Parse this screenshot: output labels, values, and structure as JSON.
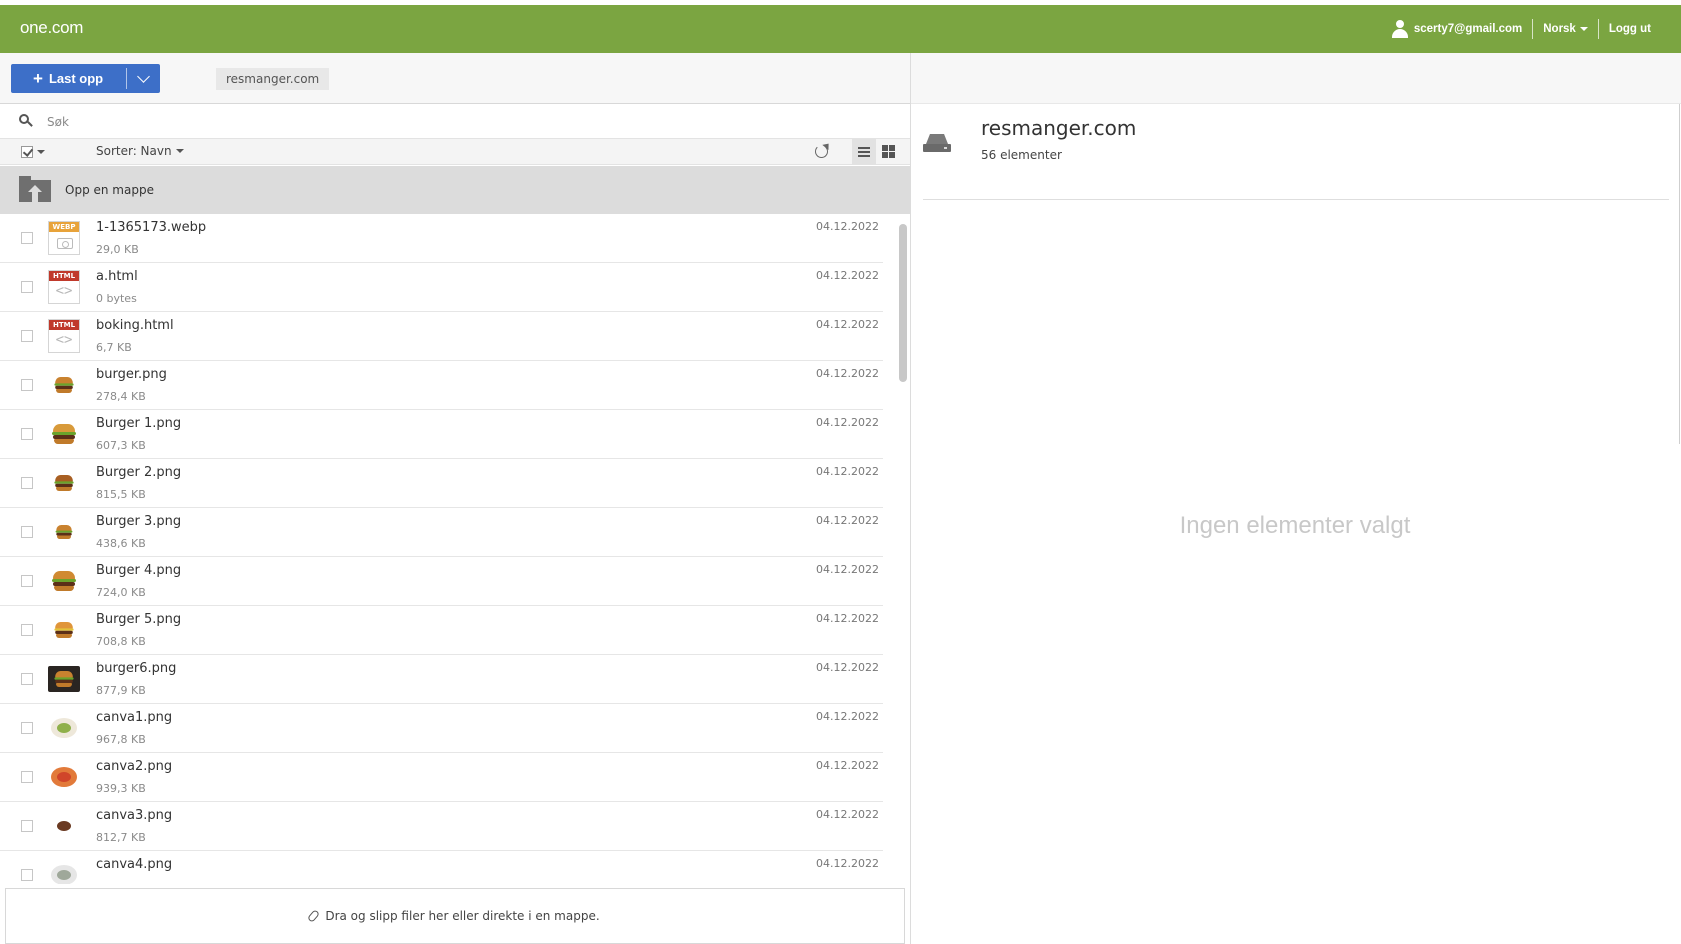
{
  "header": {
    "logo": "one.com",
    "user_email": "scerty7@gmail.com",
    "language": "Norsk",
    "logout": "Logg ut"
  },
  "toolbar": {
    "upload_label": "Last opp",
    "breadcrumb": "resmanger.com"
  },
  "search": {
    "placeholder": "Søk"
  },
  "sort": {
    "label": "Sorter: Navn"
  },
  "up_folder": {
    "label": "Opp en mappe"
  },
  "files": [
    {
      "name": "1-1365173.webp",
      "size": "29,0 KB",
      "date": "04.12.2022",
      "icon": "webp-file-icon"
    },
    {
      "name": "a.html",
      "size": "0 bytes",
      "date": "04.12.2022",
      "icon": "html-file-icon"
    },
    {
      "name": "boking.html",
      "size": "6,7 KB",
      "date": "04.12.2022",
      "icon": "html-file-icon"
    },
    {
      "name": "burger.png",
      "size": "278,4 KB",
      "date": "04.12.2022",
      "icon": "burger-thumbnail"
    },
    {
      "name": "Burger 1.png",
      "size": "607,3 KB",
      "date": "04.12.2022",
      "icon": "burger-thumbnail"
    },
    {
      "name": "Burger 2.png",
      "size": "815,5 KB",
      "date": "04.12.2022",
      "icon": "burger-thumbnail"
    },
    {
      "name": "Burger 3.png",
      "size": "438,6 KB",
      "date": "04.12.2022",
      "icon": "burger-thumbnail"
    },
    {
      "name": "Burger 4.png",
      "size": "724,0 KB",
      "date": "04.12.2022",
      "icon": "burger-thumbnail"
    },
    {
      "name": "Burger 5.png",
      "size": "708,8 KB",
      "date": "04.12.2022",
      "icon": "burger-thumbnail"
    },
    {
      "name": "burger6.png",
      "size": "877,9 KB",
      "date": "04.12.2022",
      "icon": "burger-dark-thumbnail"
    },
    {
      "name": "canva1.png",
      "size": "967,8 KB",
      "date": "04.12.2022",
      "icon": "salad-thumbnail"
    },
    {
      "name": "canva2.png",
      "size": "939,3 KB",
      "date": "04.12.2022",
      "icon": "pizza-thumbnail"
    },
    {
      "name": "canva3.png",
      "size": "812,7 KB",
      "date": "04.12.2022",
      "icon": "dish-thumbnail"
    },
    {
      "name": "canva4.png",
      "size": "",
      "date": "04.12.2022",
      "icon": "plate-thumbnail"
    }
  ],
  "drop_zone": {
    "text": "Dra og slipp filer her eller direkte i en mappe."
  },
  "details_panel": {
    "title": "resmanger.com",
    "count": "56 elementer",
    "empty_message": "Ingen elementer valgt"
  },
  "colors": {
    "header_bg": "#7ba541",
    "upload_button": "#3d6fc8",
    "up_folder_bg": "#dcdcdc",
    "webp_tag": "#e8a33a",
    "html_tag": "#c0392b"
  }
}
